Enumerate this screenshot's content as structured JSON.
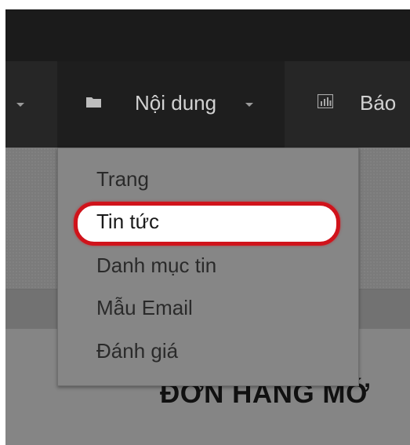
{
  "navbar": {
    "content_menu_label": "Nội dung",
    "reports_label": "Báo"
  },
  "dropdown": {
    "items": [
      {
        "label": "Trang"
      },
      {
        "label": "Tin tức",
        "highlighted": true
      },
      {
        "label": "Danh mục tin"
      },
      {
        "label": "Mẫu Email"
      },
      {
        "label": "Đánh giá"
      }
    ],
    "highlight_color": "#d0131b"
  },
  "page": {
    "heading": "ĐƠN HANG MỚ"
  },
  "icons": [
    "folder-icon",
    "bar-chart-icon",
    "chevron-down-icon"
  ]
}
